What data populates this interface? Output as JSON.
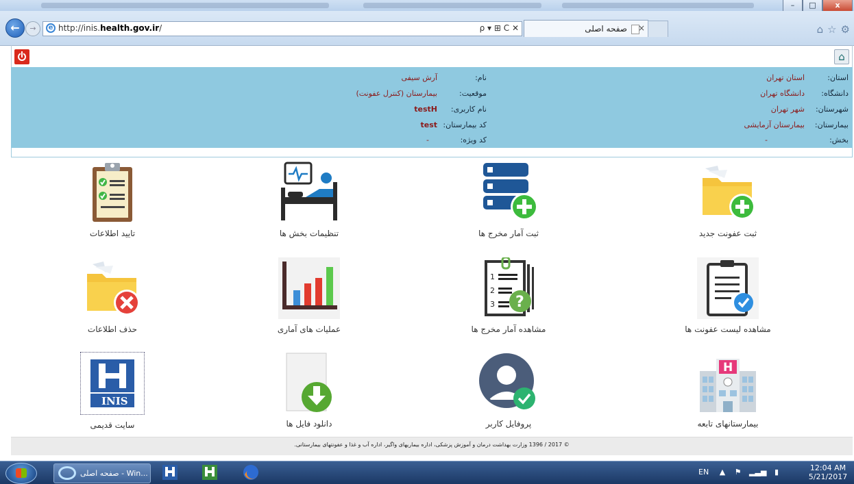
{
  "browser": {
    "url_prefix": "http://inis.",
    "url_domain": "health.gov.ir",
    "url_suffix": "/",
    "address_tools": "ρ ▾ ⊞ C ✕",
    "tab_title": "صفحه اصلی",
    "tab_close": "×",
    "back_glyph": "←",
    "forward_glyph": "→",
    "win_min": "–",
    "win_max": "□",
    "win_close": "x",
    "home_glyph": "⌂",
    "star_glyph": "☆",
    "gear_glyph": "⚙"
  },
  "page": {
    "home_glyph": "⌂",
    "info": {
      "name_label": "نام:",
      "name_value": "آرش سیفی",
      "position_label": "موقعیت:",
      "position_value": "بیمارستان (کنترل عفونت)",
      "username_label": "نام کاربری:",
      "username_value": "testH",
      "hospital_code_label": "کد بیمارستان:",
      "hospital_code_value": "test",
      "special_code_label": "کد ویژه:",
      "special_code_value": "-",
      "province_label": "استان:",
      "province_value": "استان تهران",
      "university_label": "دانشگاه:",
      "university_value": "دانشگاه تهران",
      "city_label": "شهرستان:",
      "city_value": "شهر تهران",
      "hospital_label": "بیمارستان:",
      "hospital_value": "بیمارستان آزمایشی",
      "ward_label": "بخش:",
      "ward_value": "-"
    },
    "tiles": {
      "new_infection": "ثبت عفونت جدید",
      "discharge_stats": "ثبت آمار مخرج ها",
      "ward_settings": "تنظیمات بخش ها",
      "confirm_data": "تایید اطلاعات",
      "infection_list": "مشاهده لیست عفونت ها",
      "view_discharge": "مشاهده آمار مخرج ها",
      "statistical_ops": "عملیات های آماری",
      "delete_data": "حذف اطلاعات",
      "affiliated_hospitals": "بیمارستانهای تابعه",
      "user_profile": "پروفایل کاربر",
      "download_files": "دانلود فایل ها",
      "old_site": "سایت قدیمی"
    },
    "old_site_logo_text": "INIS",
    "old_site_logo_letter": "H",
    "footer": "© 2017 / 1396 وزارت بهداشت درمان و آموزش پزشکی، اداره بیماریهای واگیر، اداره آب و غذا و عفونتهای بیمارستانی."
  },
  "taskbar": {
    "ie_item": "صفحه اصلی - Win...",
    "lang": "EN",
    "time": "12:04 AM",
    "date": "5/21/2017"
  },
  "colors": {
    "info_bg": "#8fc9e0",
    "value_text": "#8b1a1a",
    "power_red": "#d92a1c",
    "green_plus": "#3dbb3d",
    "navy_icon": "#1f4e8c"
  }
}
